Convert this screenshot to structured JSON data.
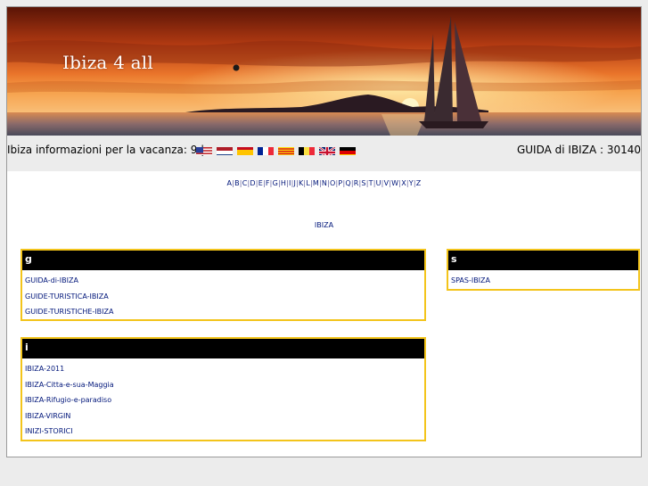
{
  "banner": {
    "title": "Ibiza 4 all"
  },
  "infobar": {
    "info_text": "Ibiza informazioni per la vacanza: 9 |",
    "guide_text": "GUIDA di IBIZA : 30140",
    "flags": [
      "us-flag",
      "nl-flag",
      "es-flag",
      "fr-flag",
      "catalan-flag",
      "be-flag",
      "uk-flag",
      "de-flag"
    ]
  },
  "alphabet": [
    "A",
    "B",
    "C",
    "D",
    "E",
    "F",
    "G",
    "H",
    "I",
    "J",
    "K",
    "L",
    "M",
    "N",
    "O",
    "P",
    "Q",
    "R",
    "S",
    "T",
    "U",
    "V",
    "W",
    "X",
    "Y",
    "Z"
  ],
  "center_link": "IBIZA",
  "boxes": {
    "g": {
      "letter": "g",
      "links": [
        "GUIDA-di-IBIZA",
        "GUIDE-TURISTICA-IBIZA",
        "GUIDE-TURISTICHE-IBIZA"
      ]
    },
    "s": {
      "letter": "s",
      "links": [
        "SPAS-IBIZA"
      ]
    },
    "i": {
      "letter": "i",
      "links": [
        "IBIZA-2011",
        "IBIZA-Citta-e-sua-Maggia",
        "IBIZA-Rifugio-e-paradiso",
        "IBIZA-VIRGIN",
        "INIZI-STORICI"
      ]
    }
  },
  "colors": {
    "box_border": "#f3c41b",
    "box_header": "#000000",
    "link": "#00167a",
    "page_bg": "#ececec"
  }
}
